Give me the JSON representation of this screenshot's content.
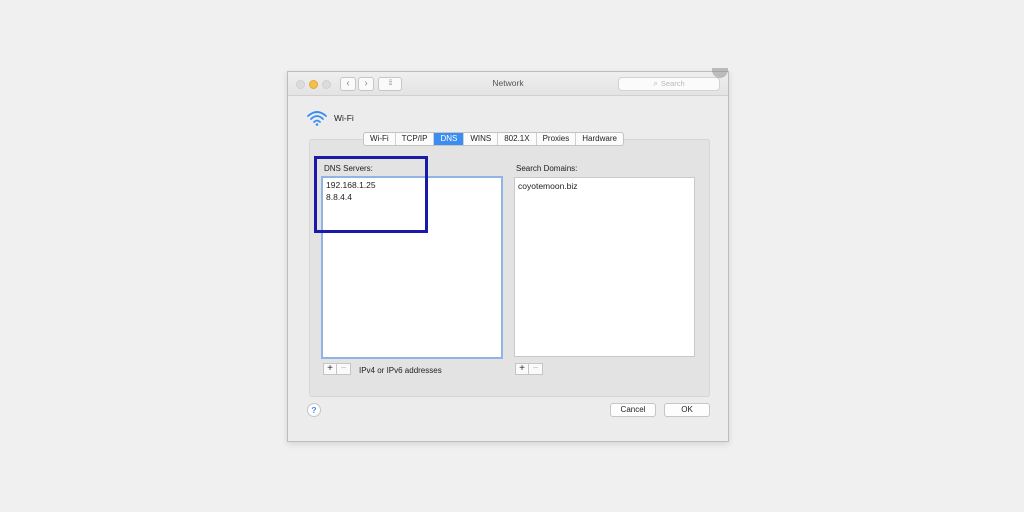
{
  "window": {
    "title": "Network"
  },
  "search": {
    "placeholder": "Search"
  },
  "icons": {
    "search": "magnifier-icon",
    "wifi": "wifi-icon",
    "help": "question-mark-icon"
  },
  "titlebar": {
    "back": "‹",
    "forward": "›",
    "grid": "⁞⁞⁞"
  },
  "interface": {
    "name": "Wi-Fi"
  },
  "tabs": [
    {
      "label": "Wi-Fi",
      "active": false
    },
    {
      "label": "TCP/IP",
      "active": false
    },
    {
      "label": "DNS",
      "active": true
    },
    {
      "label": "WINS",
      "active": false
    },
    {
      "label": "802.1X",
      "active": false
    },
    {
      "label": "Proxies",
      "active": false
    },
    {
      "label": "Hardware",
      "active": false
    }
  ],
  "dns": {
    "label": "DNS Servers:",
    "servers": [
      "192.168.1.25",
      "8.8.4.4"
    ],
    "hint": "IPv4 or IPv6 addresses"
  },
  "domains": {
    "label": "Search Domains:",
    "items": [
      "coyotemoon.biz"
    ]
  },
  "controls": {
    "plus": "+",
    "minus": "−"
  },
  "buttons": {
    "help": "?",
    "cancel": "Cancel",
    "ok": "OK"
  },
  "colors": {
    "accent": "#3b8ef0",
    "highlight_box": "#1a1aa8",
    "traffic_yellow": "#f5be4f"
  }
}
